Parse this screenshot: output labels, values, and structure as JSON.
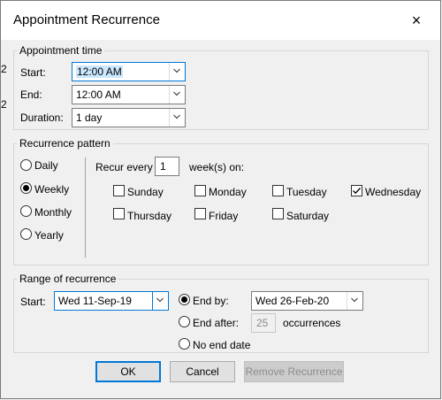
{
  "dialog": {
    "title": "Appointment Recurrence",
    "close_glyph": "×"
  },
  "appointment_time": {
    "legend": "Appointment time",
    "start_label": "Start:",
    "start_value": "12:00 AM",
    "end_label": "End:",
    "end_value": "12:00 AM",
    "duration_label": "Duration:",
    "duration_value": "1 day"
  },
  "recurrence_pattern": {
    "legend": "Recurrence pattern",
    "frequencies": [
      {
        "label": "Daily",
        "selected": false
      },
      {
        "label": "Weekly",
        "selected": true
      },
      {
        "label": "Monthly",
        "selected": false
      },
      {
        "label": "Yearly",
        "selected": false
      }
    ],
    "recur_every_label": "Recur every",
    "recur_every_value": "1",
    "weeks_on_label": "week(s) on:",
    "days": [
      {
        "label": "Sunday",
        "checked": false
      },
      {
        "label": "Monday",
        "checked": false
      },
      {
        "label": "Tuesday",
        "checked": false
      },
      {
        "label": "Wednesday",
        "checked": true
      },
      {
        "label": "Thursday",
        "checked": false
      },
      {
        "label": "Friday",
        "checked": false
      },
      {
        "label": "Saturday",
        "checked": false
      }
    ]
  },
  "range": {
    "legend": "Range of recurrence",
    "start_label": "Start:",
    "start_value": "Wed 11-Sep-19",
    "end_by_label": "End by:",
    "end_by_value": "Wed 26-Feb-20",
    "end_by_selected": true,
    "end_after_label": "End after:",
    "end_after_value": "25",
    "occurrences_label": "occurrences",
    "no_end_label": "No end date"
  },
  "buttons": {
    "ok": "OK",
    "cancel": "Cancel",
    "remove": "Remove Recurrence"
  },
  "background_fragments": [
    "2",
    "2"
  ]
}
